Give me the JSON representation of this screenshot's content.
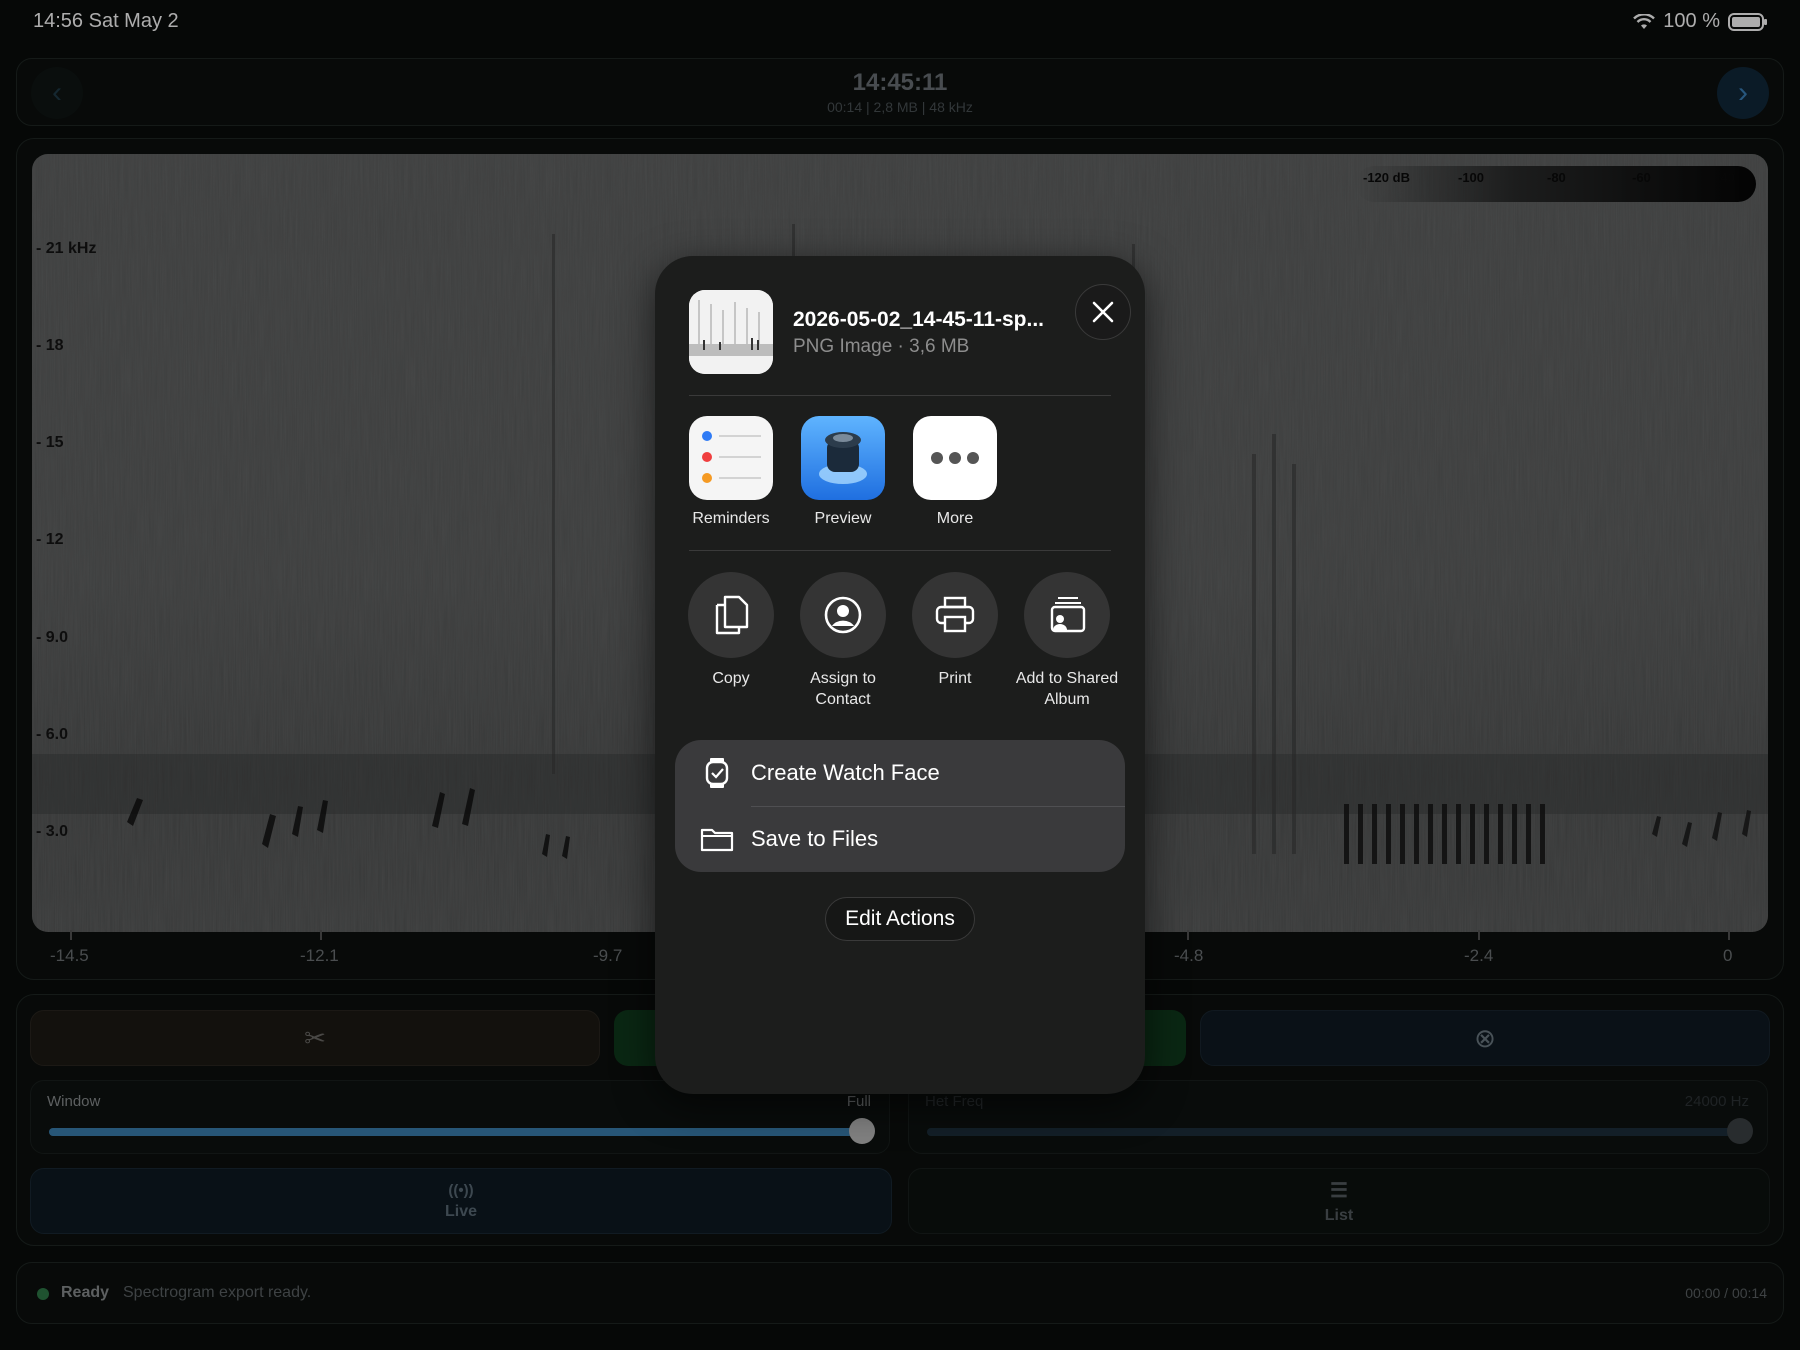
{
  "status_bar": {
    "time_date": "14:56  Sat May 2",
    "battery": "100 %"
  },
  "header": {
    "prev_icon": "‹",
    "next_icon": "›",
    "title": "14:45:11",
    "subtitle": "00:14 | 2,8 MB | 48 kHz"
  },
  "spectrogram": {
    "db_scale": [
      "-120 dB",
      "-100",
      "-80",
      "-60",
      "-40"
    ],
    "y_labels": [
      "- 21 kHz",
      "- 18",
      "- 15",
      "- 12",
      "- 9.0",
      "- 6.0",
      "- 3.0"
    ],
    "x_labels": [
      "-14.5",
      "-12.1",
      "-9.7",
      "-4.8",
      "-2.4",
      "0"
    ]
  },
  "controls": {
    "cut_icon": "✂",
    "cancel_icon": "⊗",
    "window_label": "Window",
    "window_value": "Full",
    "window_level": 1.0,
    "het_label": "Het Freq",
    "het_value": "24000 Hz",
    "het_level": 1.0,
    "live_icon": "((•))",
    "live_label": "Live",
    "list_icon": "☰",
    "list_label": "List"
  },
  "footer": {
    "status": "Ready",
    "message": "Spectrogram export ready.",
    "time": "00:00 / 00:14"
  },
  "share_sheet": {
    "file_name": "2026-05-02_14-45-11-sp...",
    "file_meta": "PNG Image · 3,6 MB",
    "apps": [
      {
        "label": "Reminders",
        "icon": "reminders-icon"
      },
      {
        "label": "Preview",
        "icon": "preview-icon"
      },
      {
        "label": "More",
        "icon": "more-icon"
      }
    ],
    "actions": [
      {
        "label": "Copy",
        "icon": "copy-icon"
      },
      {
        "label": "Assign to Contact",
        "icon": "contact-icon"
      },
      {
        "label": "Print",
        "icon": "print-icon"
      },
      {
        "label": "Add to Shared Album",
        "icon": "shared-album-icon"
      }
    ],
    "list": [
      {
        "label": "Create Watch Face",
        "icon": "watch-icon"
      },
      {
        "label": "Save to Files",
        "icon": "folder-icon"
      }
    ],
    "edit_actions": "Edit Actions"
  }
}
